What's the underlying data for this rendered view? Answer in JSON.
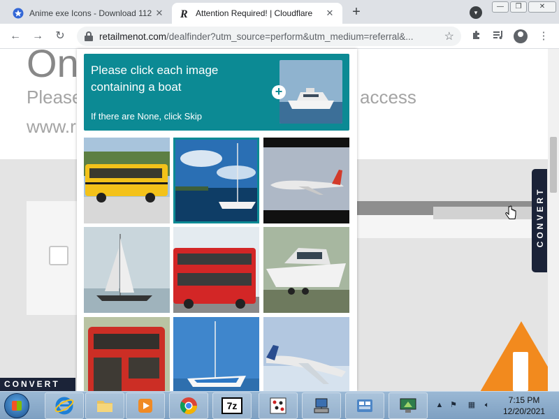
{
  "browser": {
    "tabs": [
      {
        "title": "Anime exe Icons - Download 112",
        "favicon": "star-badge-icon",
        "active": false
      },
      {
        "title": "Attention Required! | Cloudflare",
        "favicon": "r-logo-icon",
        "active": true
      }
    ],
    "new_tab": "+",
    "url_host": "retailmenot.com",
    "url_rest": "/dealfinder?utm_source=perform&utm_medium=referral&..."
  },
  "page": {
    "heading": "On",
    "line1_left": "Please",
    "line1_right": "access",
    "line2": "www.r"
  },
  "captcha": {
    "prompt": "Please click each image containing a boat",
    "skip_hint": "If there are None, click Skip",
    "tiles": [
      {
        "subject": "yellow school bus",
        "selected": false
      },
      {
        "subject": "sailboat at marina",
        "selected": true
      },
      {
        "subject": "airplane",
        "selected": false
      },
      {
        "subject": "sailboat on water",
        "selected": false
      },
      {
        "subject": "red double-decker bus",
        "selected": false
      },
      {
        "subject": "motorboat on trailer",
        "selected": false
      },
      {
        "subject": "red bus",
        "selected": false
      },
      {
        "subject": "sailboat on sea",
        "selected": false
      },
      {
        "subject": "airplane in water",
        "selected": false
      }
    ]
  },
  "badges": {
    "convert_side": "CONVERT",
    "convert_bottom": "CONVERT"
  },
  "taskbar": {
    "apps": [
      "internet-explorer",
      "file-explorer",
      "media-player",
      "chrome",
      "7-zip",
      "app-dotted",
      "network-tool",
      "control-panel",
      "remote-desktop"
    ],
    "app_7z_label": "7z",
    "time": "7:15 PM",
    "date": "12/20/2021"
  },
  "colors": {
    "captcha_teal": "#0c8a94",
    "warning_orange": "#f28a1e",
    "convert_navy": "#1b2338"
  }
}
